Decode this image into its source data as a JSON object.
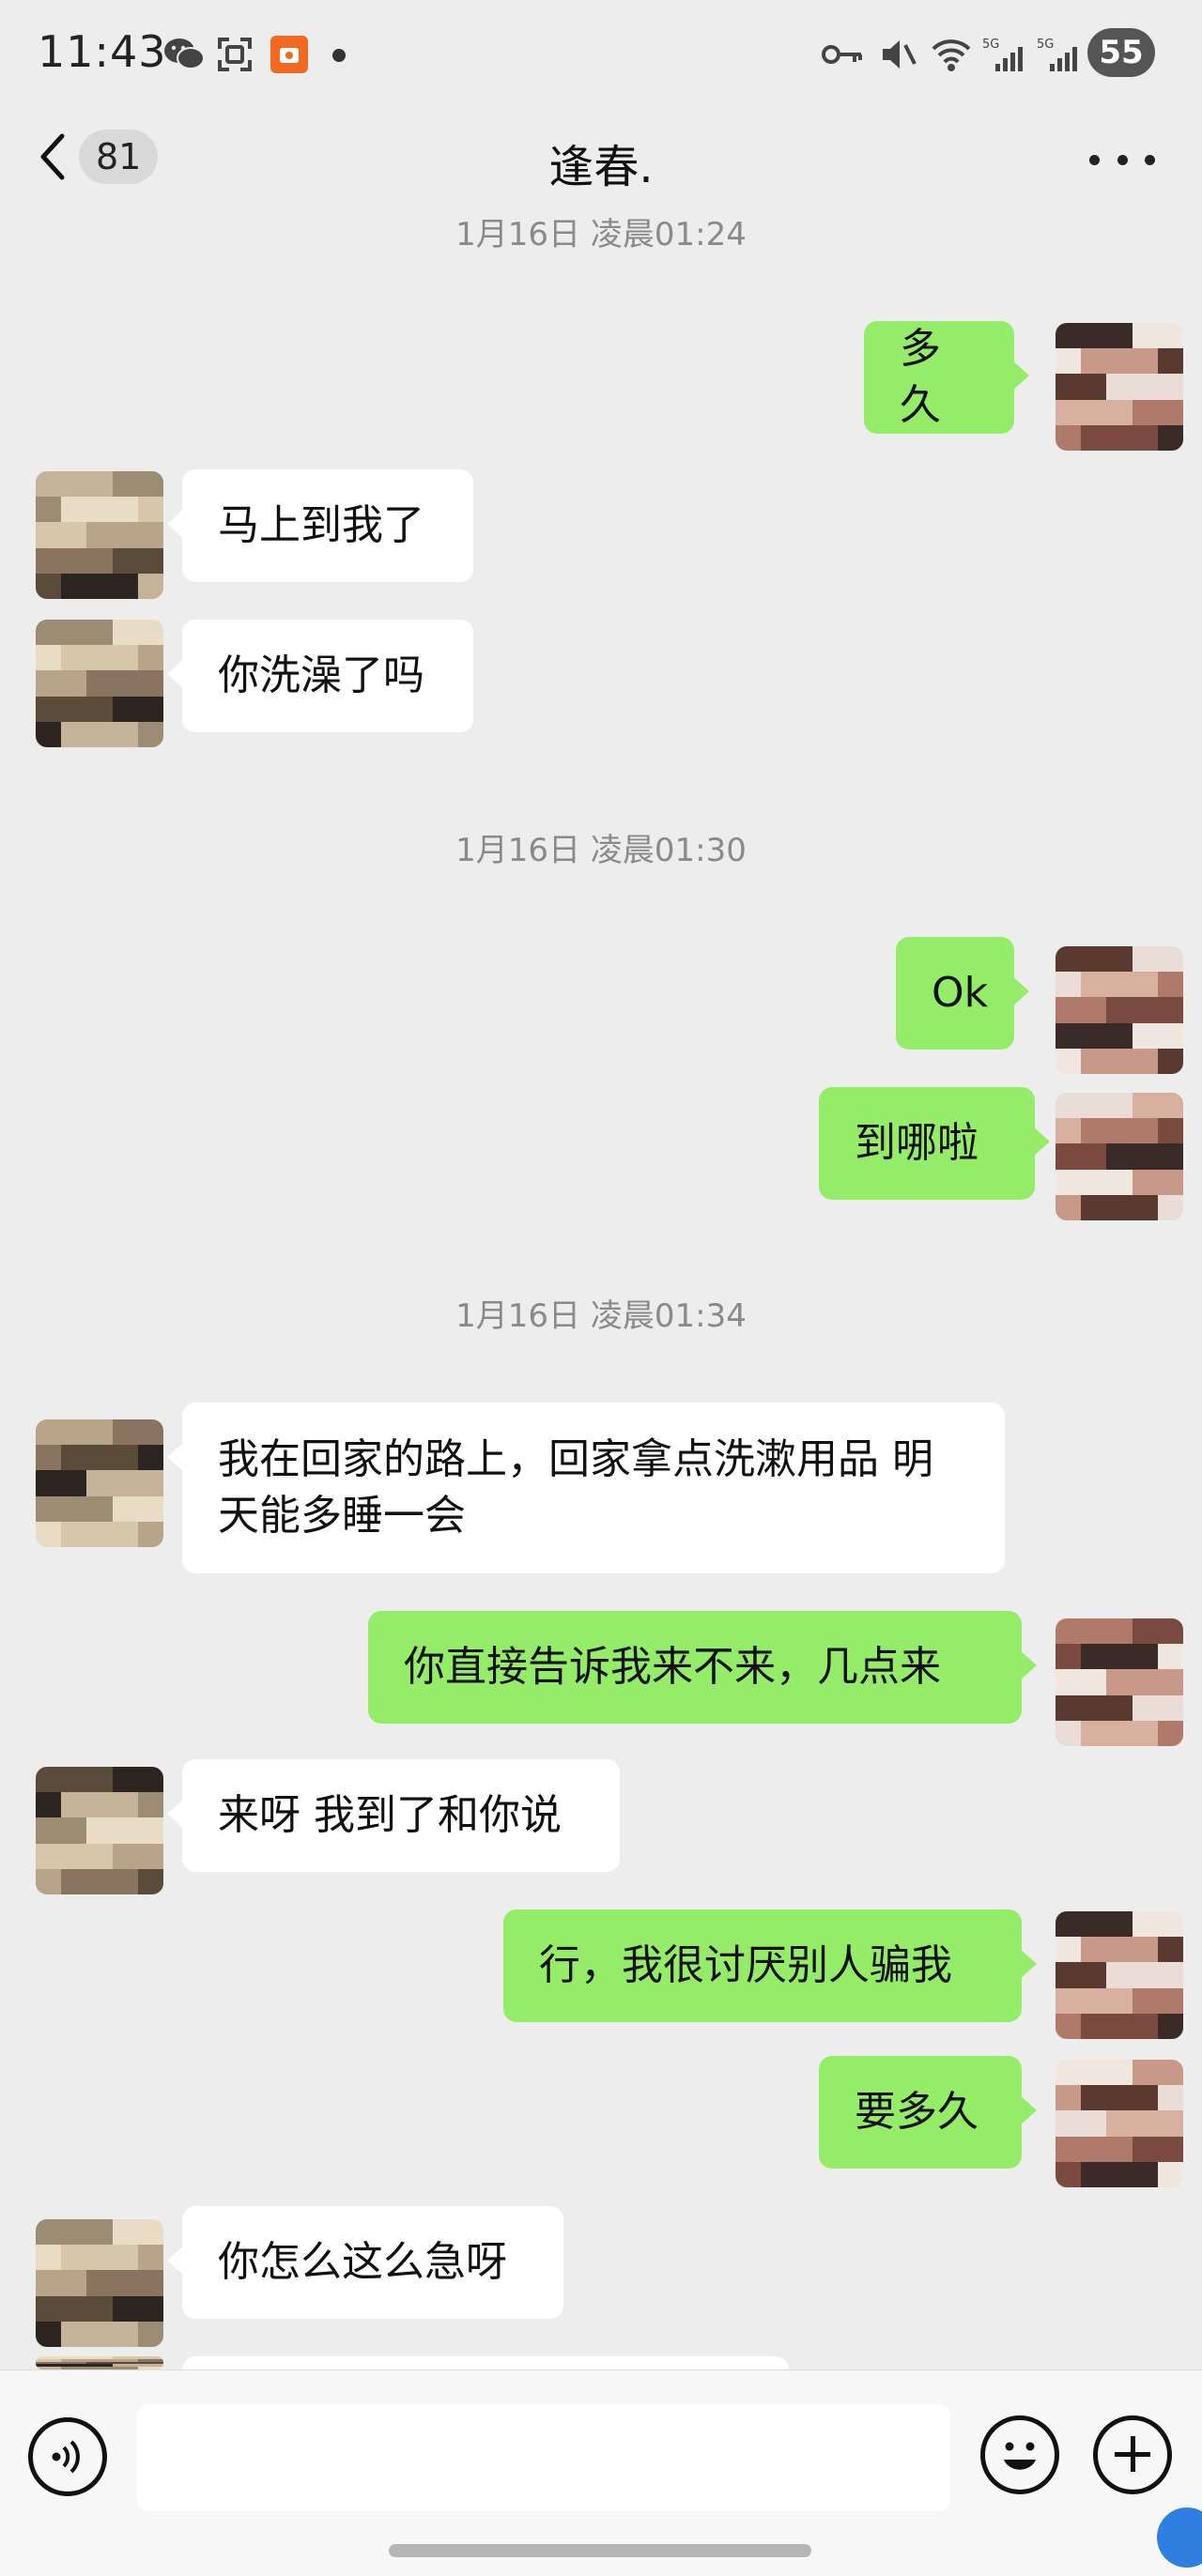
{
  "status": {
    "time": "11:43",
    "battery": "55"
  },
  "header": {
    "unread_count": "81",
    "title": "逢春."
  },
  "messages": [
    {
      "type": "timestamp",
      "text": "1月16日 凌晨01:24"
    },
    {
      "type": "out",
      "text": "多久"
    },
    {
      "type": "in",
      "text": "马上到我了"
    },
    {
      "type": "in",
      "text": "你洗澡了吗"
    },
    {
      "type": "timestamp",
      "text": "1月16日 凌晨01:30"
    },
    {
      "type": "out",
      "text": "Ok"
    },
    {
      "type": "out",
      "text": "到哪啦"
    },
    {
      "type": "timestamp",
      "text": "1月16日 凌晨01:34"
    },
    {
      "type": "in",
      "line1": "我在回家的路上，回家拿点洗漱用品 明",
      "line2": "天能多睡一会"
    },
    {
      "type": "out",
      "text": "你直接告诉我来不来，几点来"
    },
    {
      "type": "in",
      "text": "来呀 我到了和你说"
    },
    {
      "type": "out",
      "text": "行，我很讨厌别人骗我"
    },
    {
      "type": "out",
      "text": "要多久"
    },
    {
      "type": "in",
      "text": "你怎么这么急呀"
    }
  ],
  "input": {
    "placeholder": ""
  },
  "icons": [
    "wechat-icon",
    "scan-icon",
    "app-icon",
    "key-icon",
    "mute-icon",
    "wifi-icon",
    "signal-5g-icon",
    "back-chevron-icon",
    "more-icon",
    "voice-icon",
    "emoji-icon",
    "plus-icon"
  ],
  "colors": {
    "background": "#ededed",
    "incoming_bubble": "#ffffff",
    "outgoing_bubble": "#95ec69"
  }
}
